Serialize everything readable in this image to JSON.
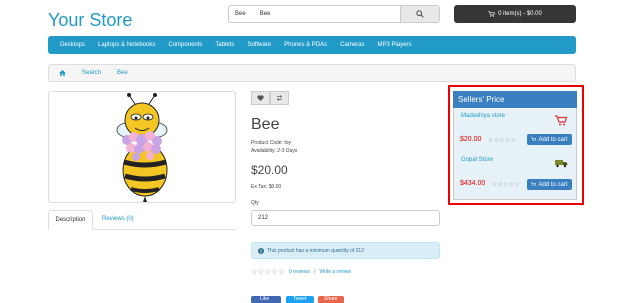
{
  "header": {
    "logo": "Your Store",
    "search_value": "Bee",
    "search_value_2": "Bee",
    "cart_label": "0 item(s) - $0.00"
  },
  "nav": [
    "Desktops",
    "Laptops & Notebooks",
    "Components",
    "Tablets",
    "Software",
    "Phones & PDAs",
    "Cameras",
    "MP3 Players"
  ],
  "breadcrumb": [
    "Search",
    "Bee"
  ],
  "product": {
    "title": "Bee",
    "code": "Product Code: toy",
    "availability": "Availability: 2-3 Days",
    "price": "$20.00",
    "ex_tax": "Ex Tax: $0.00",
    "qty_label": "Qty",
    "qty_value": "212",
    "alert": "This product has a minimum quantity of 212",
    "reviews_link": "0 reviews",
    "write_review": "Write a review",
    "reviews_sep": "/"
  },
  "tabs": {
    "description": "Description",
    "reviews": "Reviews (0)"
  },
  "share": {
    "like": "Like",
    "tweet": "Tweet",
    "share": "Share"
  },
  "sellers": {
    "title": "Sellers' Price",
    "items": [
      {
        "name": "Madeshiya store",
        "price": "$20.00",
        "button": "Add to cart"
      },
      {
        "name": "Gopal Store",
        "price": "$434.00",
        "button": "Add to cart"
      }
    ]
  },
  "colors": {
    "brand": "#229ac8",
    "highlight": "#ee0000",
    "panel_header": "#3a7fc0"
  }
}
